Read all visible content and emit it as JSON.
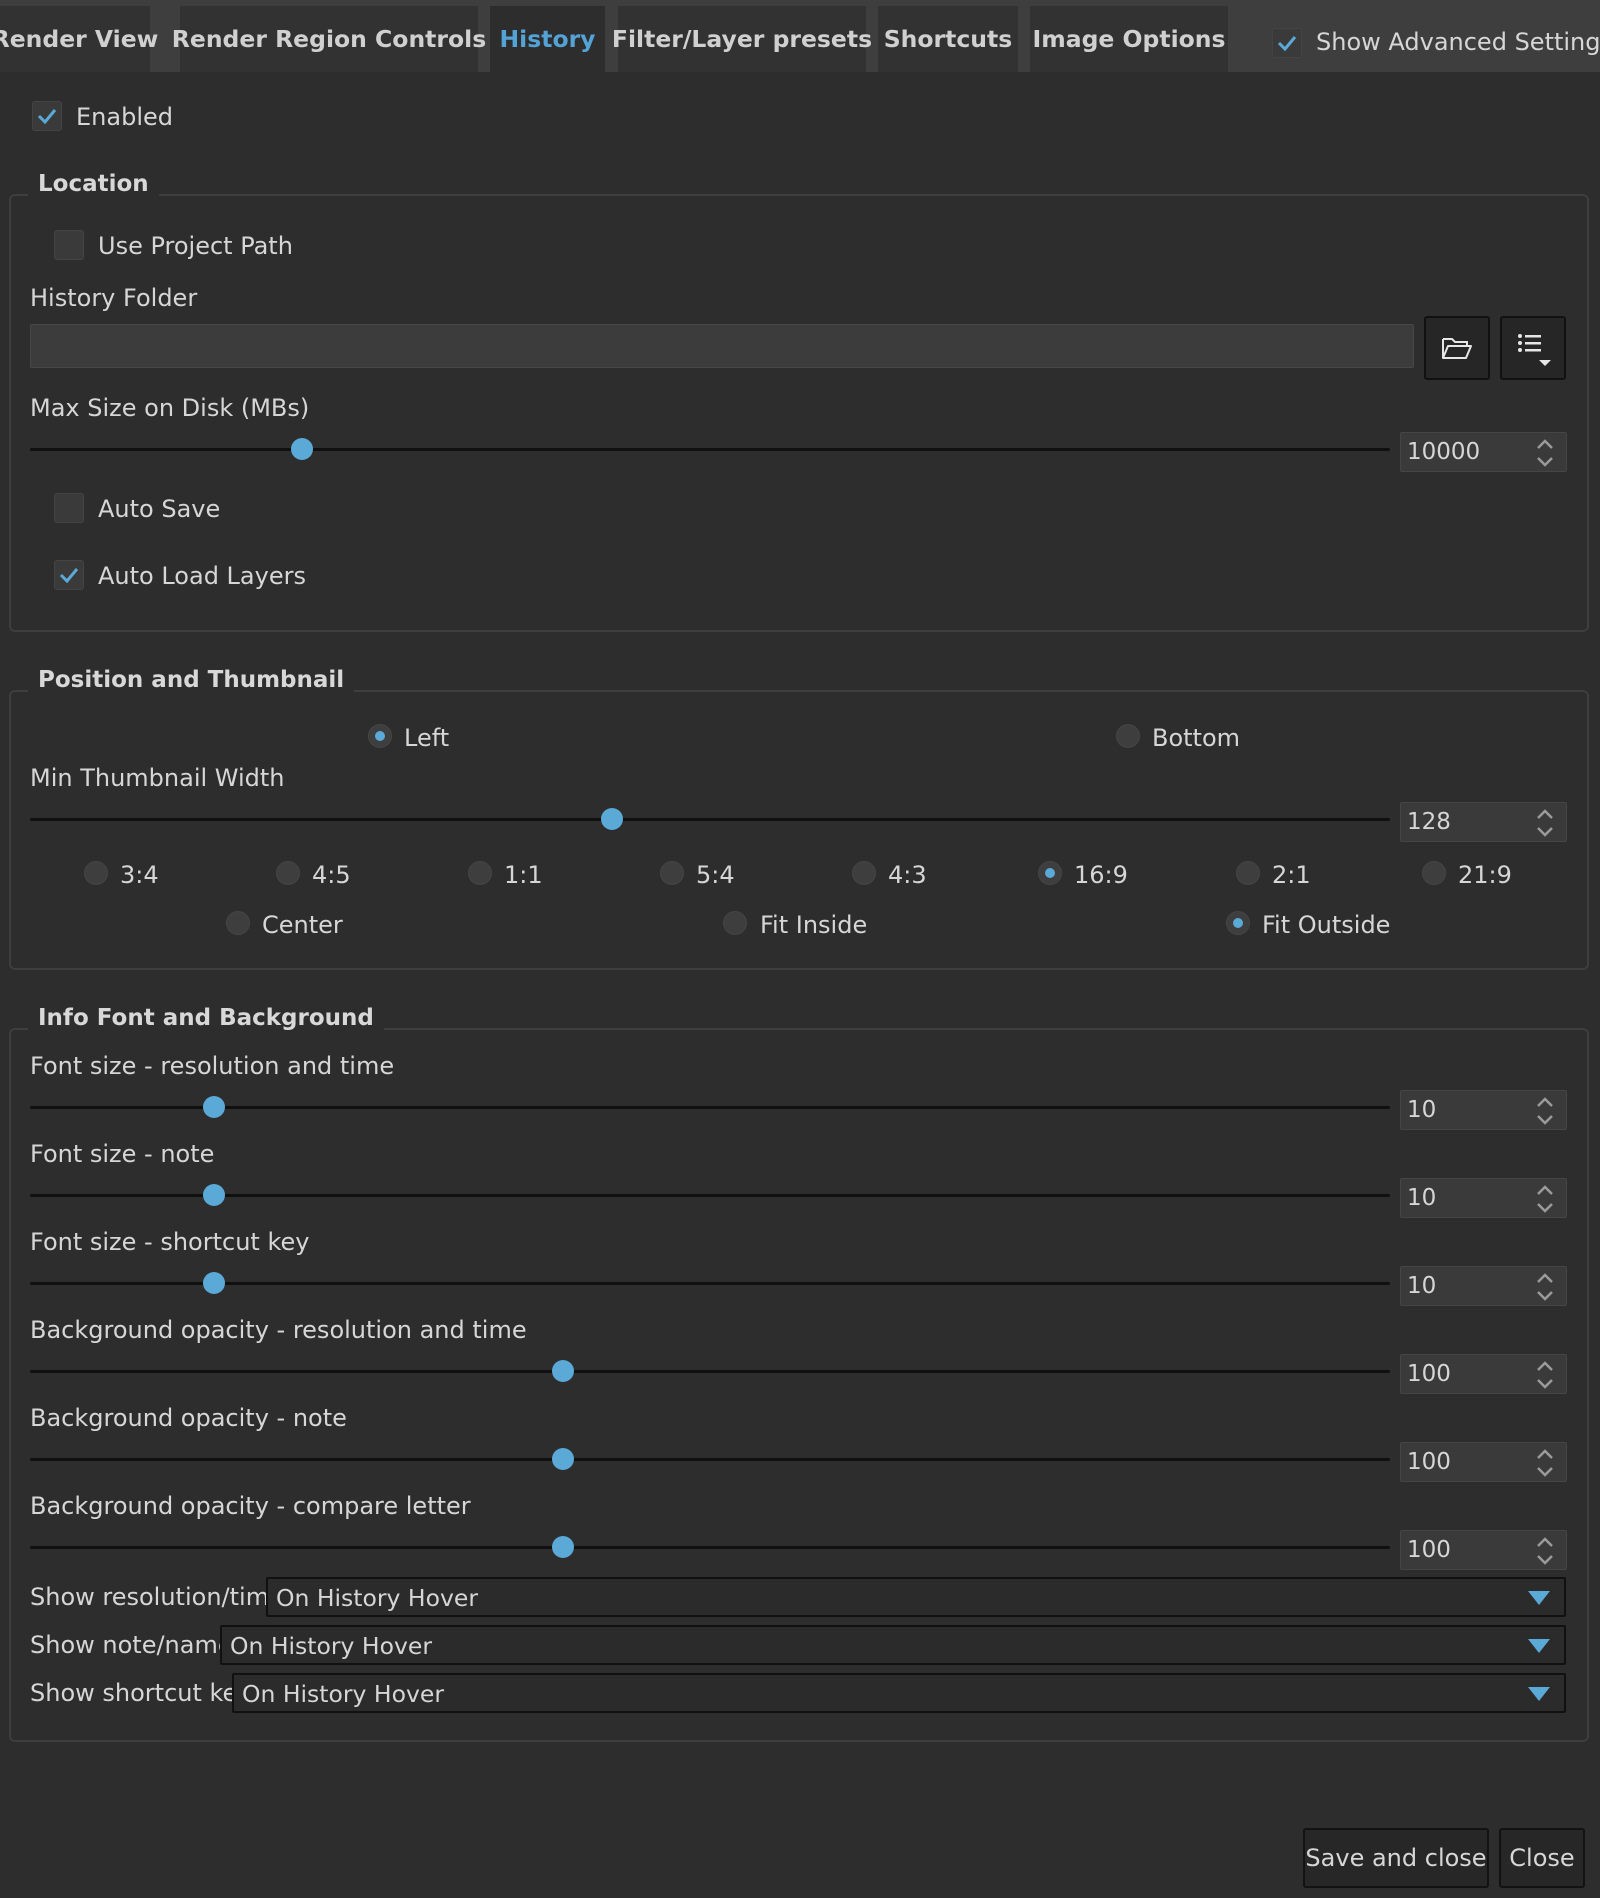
{
  "tabs": [
    {
      "label": "Render View"
    },
    {
      "label": "Render Region Controls"
    },
    {
      "label": "History"
    },
    {
      "label": "Filter/Layer presets"
    },
    {
      "label": "Shortcuts"
    },
    {
      "label": "Image Options"
    }
  ],
  "header": {
    "advanced_label": "Show Advanced Settings",
    "advanced_checked": true
  },
  "enabled": {
    "label": "Enabled",
    "checked": true
  },
  "location": {
    "title": "Location",
    "use_project_path": {
      "label": "Use Project Path",
      "checked": false
    },
    "history_folder_label": "History Folder",
    "history_folder_value": "",
    "max_size_label": "Max Size on Disk (MBs)",
    "max_size_value": "10000",
    "max_size_fraction": 0.2,
    "auto_save": {
      "label": "Auto Save",
      "checked": false
    },
    "auto_load_layers": {
      "label": "Auto Load Layers",
      "checked": true
    }
  },
  "position": {
    "title": "Position and Thumbnail",
    "side_options": [
      {
        "label": "Left",
        "selected": true
      },
      {
        "label": "Bottom",
        "selected": false
      }
    ],
    "min_thumb_label": "Min Thumbnail Width",
    "min_thumb_value": "128",
    "min_thumb_fraction": 0.428,
    "ratios": [
      {
        "label": "3:4",
        "selected": false
      },
      {
        "label": "4:5",
        "selected": false
      },
      {
        "label": "1:1",
        "selected": false
      },
      {
        "label": "5:4",
        "selected": false
      },
      {
        "label": "4:3",
        "selected": false
      },
      {
        "label": "16:9",
        "selected": true
      },
      {
        "label": "2:1",
        "selected": false
      },
      {
        "label": "21:9",
        "selected": false
      }
    ],
    "fit_modes": [
      {
        "label": "Center",
        "selected": false
      },
      {
        "label": "Fit Inside",
        "selected": false
      },
      {
        "label": "Fit Outside",
        "selected": true
      }
    ]
  },
  "info": {
    "title": "Info Font and Background",
    "sliders": [
      {
        "label": "Font size - resolution and time",
        "value": "10",
        "fraction": 0.135
      },
      {
        "label": "Font size - note",
        "value": "10",
        "fraction": 0.135
      },
      {
        "label": "Font size - shortcut key",
        "value": "10",
        "fraction": 0.135
      },
      {
        "label": "Background opacity - resolution and time",
        "value": "100",
        "fraction": 0.392
      },
      {
        "label": "Background opacity - note",
        "value": "100",
        "fraction": 0.392
      },
      {
        "label": "Background opacity - compare letter",
        "value": "100",
        "fraction": 0.392
      }
    ],
    "combos": [
      {
        "label": "Show resolution/time",
        "value": "On History Hover"
      },
      {
        "label": "Show note/name",
        "value": "On History Hover"
      },
      {
        "label": "Show shortcut key",
        "value": "On History Hover"
      }
    ]
  },
  "footer": {
    "save_close_label": "Save and close",
    "close_label": "Close"
  },
  "colors": {
    "accent": "#54a3d6",
    "background": "#2d2d2d",
    "tabbar": "#3e3e3e"
  }
}
